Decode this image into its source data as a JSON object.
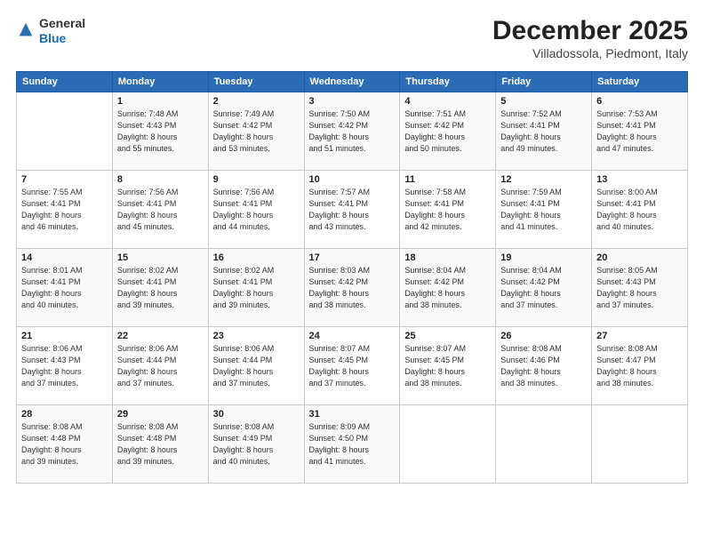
{
  "logo": {
    "general": "General",
    "blue": "Blue"
  },
  "header": {
    "month": "December 2025",
    "location": "Villadossola, Piedmont, Italy"
  },
  "days_of_week": [
    "Sunday",
    "Monday",
    "Tuesday",
    "Wednesday",
    "Thursday",
    "Friday",
    "Saturday"
  ],
  "weeks": [
    [
      {
        "day": "",
        "sunrise": "",
        "sunset": "",
        "daylight": ""
      },
      {
        "day": "1",
        "sunrise": "Sunrise: 7:48 AM",
        "sunset": "Sunset: 4:43 PM",
        "daylight": "Daylight: 8 hours and 55 minutes."
      },
      {
        "day": "2",
        "sunrise": "Sunrise: 7:49 AM",
        "sunset": "Sunset: 4:42 PM",
        "daylight": "Daylight: 8 hours and 53 minutes."
      },
      {
        "day": "3",
        "sunrise": "Sunrise: 7:50 AM",
        "sunset": "Sunset: 4:42 PM",
        "daylight": "Daylight: 8 hours and 51 minutes."
      },
      {
        "day": "4",
        "sunrise": "Sunrise: 7:51 AM",
        "sunset": "Sunset: 4:42 PM",
        "daylight": "Daylight: 8 hours and 50 minutes."
      },
      {
        "day": "5",
        "sunrise": "Sunrise: 7:52 AM",
        "sunset": "Sunset: 4:41 PM",
        "daylight": "Daylight: 8 hours and 49 minutes."
      },
      {
        "day": "6",
        "sunrise": "Sunrise: 7:53 AM",
        "sunset": "Sunset: 4:41 PM",
        "daylight": "Daylight: 8 hours and 47 minutes."
      }
    ],
    [
      {
        "day": "7",
        "sunrise": "Sunrise: 7:55 AM",
        "sunset": "Sunset: 4:41 PM",
        "daylight": "Daylight: 8 hours and 46 minutes."
      },
      {
        "day": "8",
        "sunrise": "Sunrise: 7:56 AM",
        "sunset": "Sunset: 4:41 PM",
        "daylight": "Daylight: 8 hours and 45 minutes."
      },
      {
        "day": "9",
        "sunrise": "Sunrise: 7:56 AM",
        "sunset": "Sunset: 4:41 PM",
        "daylight": "Daylight: 8 hours and 44 minutes."
      },
      {
        "day": "10",
        "sunrise": "Sunrise: 7:57 AM",
        "sunset": "Sunset: 4:41 PM",
        "daylight": "Daylight: 8 hours and 43 minutes."
      },
      {
        "day": "11",
        "sunrise": "Sunrise: 7:58 AM",
        "sunset": "Sunset: 4:41 PM",
        "daylight": "Daylight: 8 hours and 42 minutes."
      },
      {
        "day": "12",
        "sunrise": "Sunrise: 7:59 AM",
        "sunset": "Sunset: 4:41 PM",
        "daylight": "Daylight: 8 hours and 41 minutes."
      },
      {
        "day": "13",
        "sunrise": "Sunrise: 8:00 AM",
        "sunset": "Sunset: 4:41 PM",
        "daylight": "Daylight: 8 hours and 40 minutes."
      }
    ],
    [
      {
        "day": "14",
        "sunrise": "Sunrise: 8:01 AM",
        "sunset": "Sunset: 4:41 PM",
        "daylight": "Daylight: 8 hours and 40 minutes."
      },
      {
        "day": "15",
        "sunrise": "Sunrise: 8:02 AM",
        "sunset": "Sunset: 4:41 PM",
        "daylight": "Daylight: 8 hours and 39 minutes."
      },
      {
        "day": "16",
        "sunrise": "Sunrise: 8:02 AM",
        "sunset": "Sunset: 4:41 PM",
        "daylight": "Daylight: 8 hours and 39 minutes."
      },
      {
        "day": "17",
        "sunrise": "Sunrise: 8:03 AM",
        "sunset": "Sunset: 4:42 PM",
        "daylight": "Daylight: 8 hours and 38 minutes."
      },
      {
        "day": "18",
        "sunrise": "Sunrise: 8:04 AM",
        "sunset": "Sunset: 4:42 PM",
        "daylight": "Daylight: 8 hours and 38 minutes."
      },
      {
        "day": "19",
        "sunrise": "Sunrise: 8:04 AM",
        "sunset": "Sunset: 4:42 PM",
        "daylight": "Daylight: 8 hours and 37 minutes."
      },
      {
        "day": "20",
        "sunrise": "Sunrise: 8:05 AM",
        "sunset": "Sunset: 4:43 PM",
        "daylight": "Daylight: 8 hours and 37 minutes."
      }
    ],
    [
      {
        "day": "21",
        "sunrise": "Sunrise: 8:06 AM",
        "sunset": "Sunset: 4:43 PM",
        "daylight": "Daylight: 8 hours and 37 minutes."
      },
      {
        "day": "22",
        "sunrise": "Sunrise: 8:06 AM",
        "sunset": "Sunset: 4:44 PM",
        "daylight": "Daylight: 8 hours and 37 minutes."
      },
      {
        "day": "23",
        "sunrise": "Sunrise: 8:06 AM",
        "sunset": "Sunset: 4:44 PM",
        "daylight": "Daylight: 8 hours and 37 minutes."
      },
      {
        "day": "24",
        "sunrise": "Sunrise: 8:07 AM",
        "sunset": "Sunset: 4:45 PM",
        "daylight": "Daylight: 8 hours and 37 minutes."
      },
      {
        "day": "25",
        "sunrise": "Sunrise: 8:07 AM",
        "sunset": "Sunset: 4:45 PM",
        "daylight": "Daylight: 8 hours and 38 minutes."
      },
      {
        "day": "26",
        "sunrise": "Sunrise: 8:08 AM",
        "sunset": "Sunset: 4:46 PM",
        "daylight": "Daylight: 8 hours and 38 minutes."
      },
      {
        "day": "27",
        "sunrise": "Sunrise: 8:08 AM",
        "sunset": "Sunset: 4:47 PM",
        "daylight": "Daylight: 8 hours and 38 minutes."
      }
    ],
    [
      {
        "day": "28",
        "sunrise": "Sunrise: 8:08 AM",
        "sunset": "Sunset: 4:48 PM",
        "daylight": "Daylight: 8 hours and 39 minutes."
      },
      {
        "day": "29",
        "sunrise": "Sunrise: 8:08 AM",
        "sunset": "Sunset: 4:48 PM",
        "daylight": "Daylight: 8 hours and 39 minutes."
      },
      {
        "day": "30",
        "sunrise": "Sunrise: 8:08 AM",
        "sunset": "Sunset: 4:49 PM",
        "daylight": "Daylight: 8 hours and 40 minutes."
      },
      {
        "day": "31",
        "sunrise": "Sunrise: 8:09 AM",
        "sunset": "Sunset: 4:50 PM",
        "daylight": "Daylight: 8 hours and 41 minutes."
      },
      {
        "day": "",
        "sunrise": "",
        "sunset": "",
        "daylight": ""
      },
      {
        "day": "",
        "sunrise": "",
        "sunset": "",
        "daylight": ""
      },
      {
        "day": "",
        "sunrise": "",
        "sunset": "",
        "daylight": ""
      }
    ]
  ]
}
